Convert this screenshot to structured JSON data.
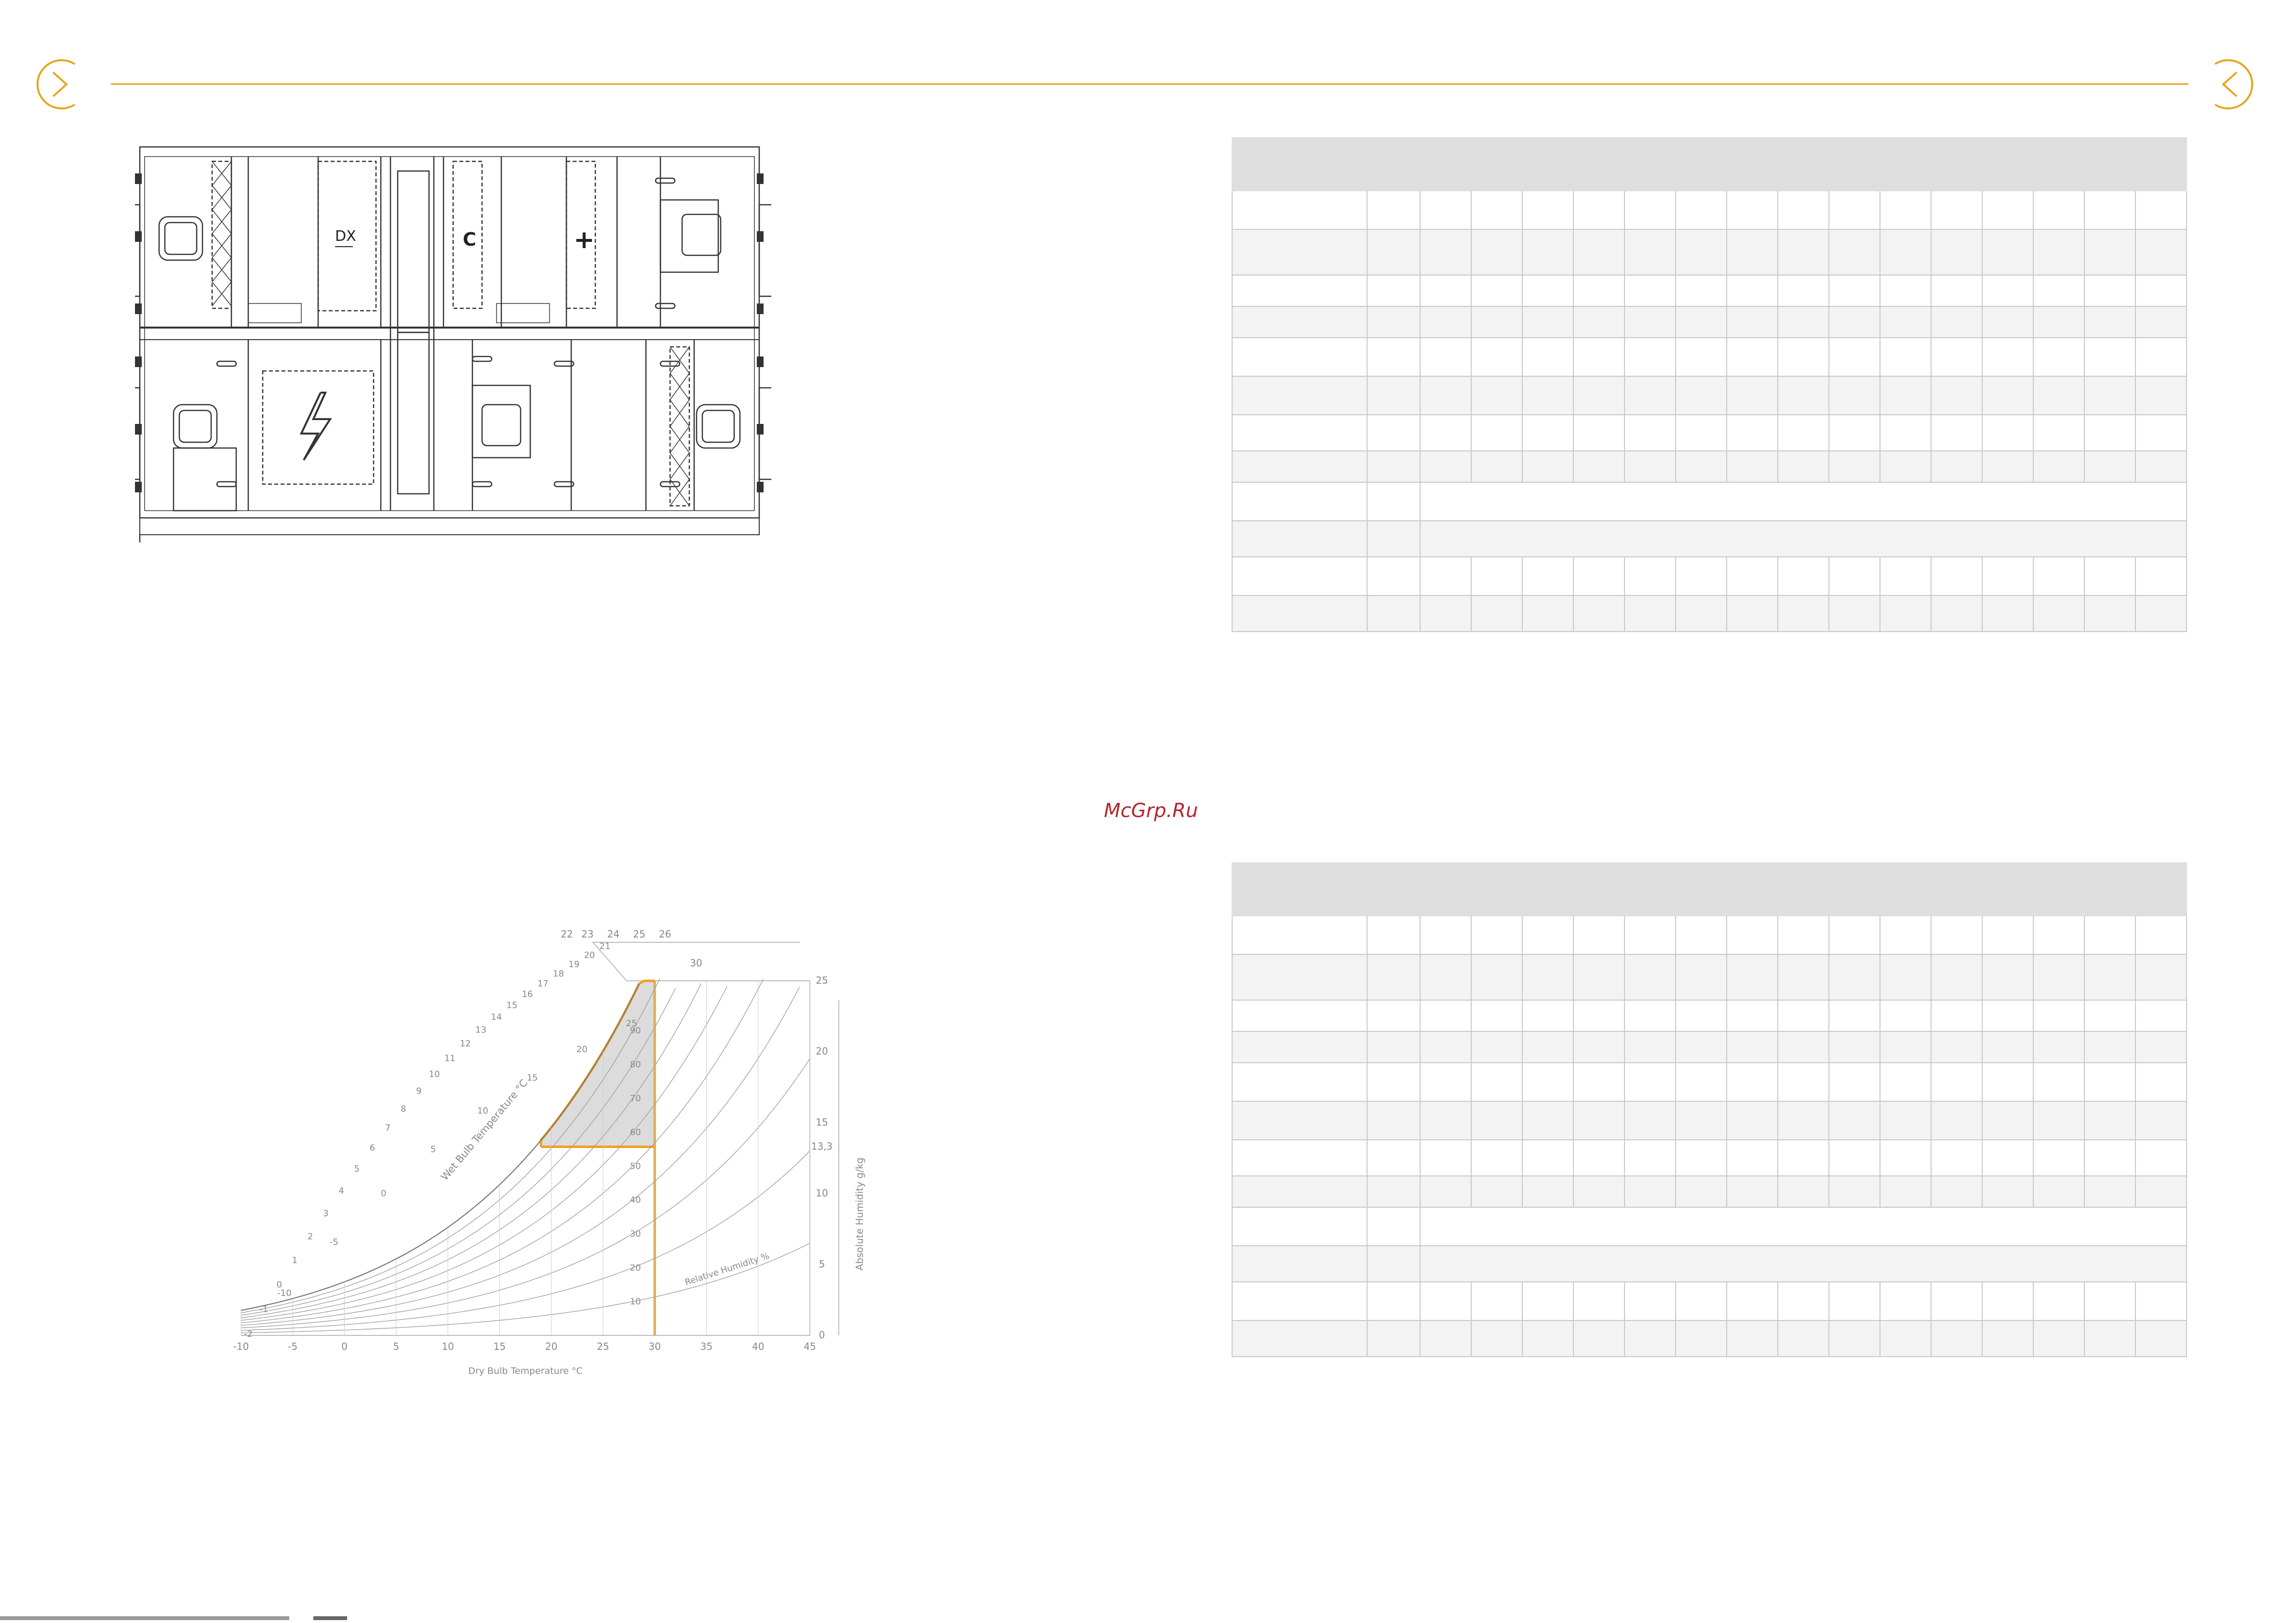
{
  "watermark": "McGrp.Ru",
  "icons": {
    "left_nav": "chevron-right-circle-icon",
    "right_nav": "chevron-left-circle-icon",
    "accent_color": "#e6a51e"
  },
  "unit_diagram": {
    "dx_label": "DX",
    "cooling_label": "C",
    "heating_label": "+"
  },
  "psychrometric_chart": {
    "x_axis_label": "Dry Bulb Temperature °C",
    "y_axis_label": "Absolute Humidity g/kg",
    "wet_bulb_label": "Wet Bulb Temperature °C",
    "rh_label": "Relative Humidity %",
    "x_ticks": [
      "-10",
      "-5",
      "0",
      "5",
      "10",
      "15",
      "20",
      "25",
      "30",
      "35",
      "40",
      "45"
    ],
    "y_ticks": [
      "0",
      "5",
      "10",
      "13,3",
      "15",
      "20",
      "25"
    ],
    "rh_values": [
      "10",
      "20",
      "30",
      "40",
      "50",
      "60",
      "70",
      "80",
      "90"
    ],
    "top_scale": [
      "22",
      "23",
      "24",
      "25",
      "26",
      "30"
    ],
    "wb_scale_left": [
      "21",
      "20",
      "19",
      "18",
      "17",
      "16",
      "15",
      "14",
      "13",
      "12",
      "11",
      "10",
      "9",
      "8",
      "7",
      "6",
      "5",
      "4",
      "3",
      "2",
      "1",
      "0",
      "-1",
      "-2"
    ],
    "wb_curve_labels": [
      "25",
      "20",
      "15",
      "10",
      "5",
      "0",
      "-5",
      "-10"
    ],
    "accent_color": "#f0a020",
    "region_fill": "#dcdcdc"
  },
  "tables": {
    "columns": 17,
    "top_rows": [
      "plain",
      "band",
      "plain",
      "band",
      "plain",
      "band",
      "plain",
      "band",
      "plain-merged",
      "band-merged",
      "plain",
      "band"
    ],
    "bottom_rows": [
      "plain",
      "band",
      "plain",
      "band",
      "plain",
      "band",
      "plain",
      "band",
      "plain-merged",
      "band-merged",
      "plain",
      "band"
    ]
  }
}
